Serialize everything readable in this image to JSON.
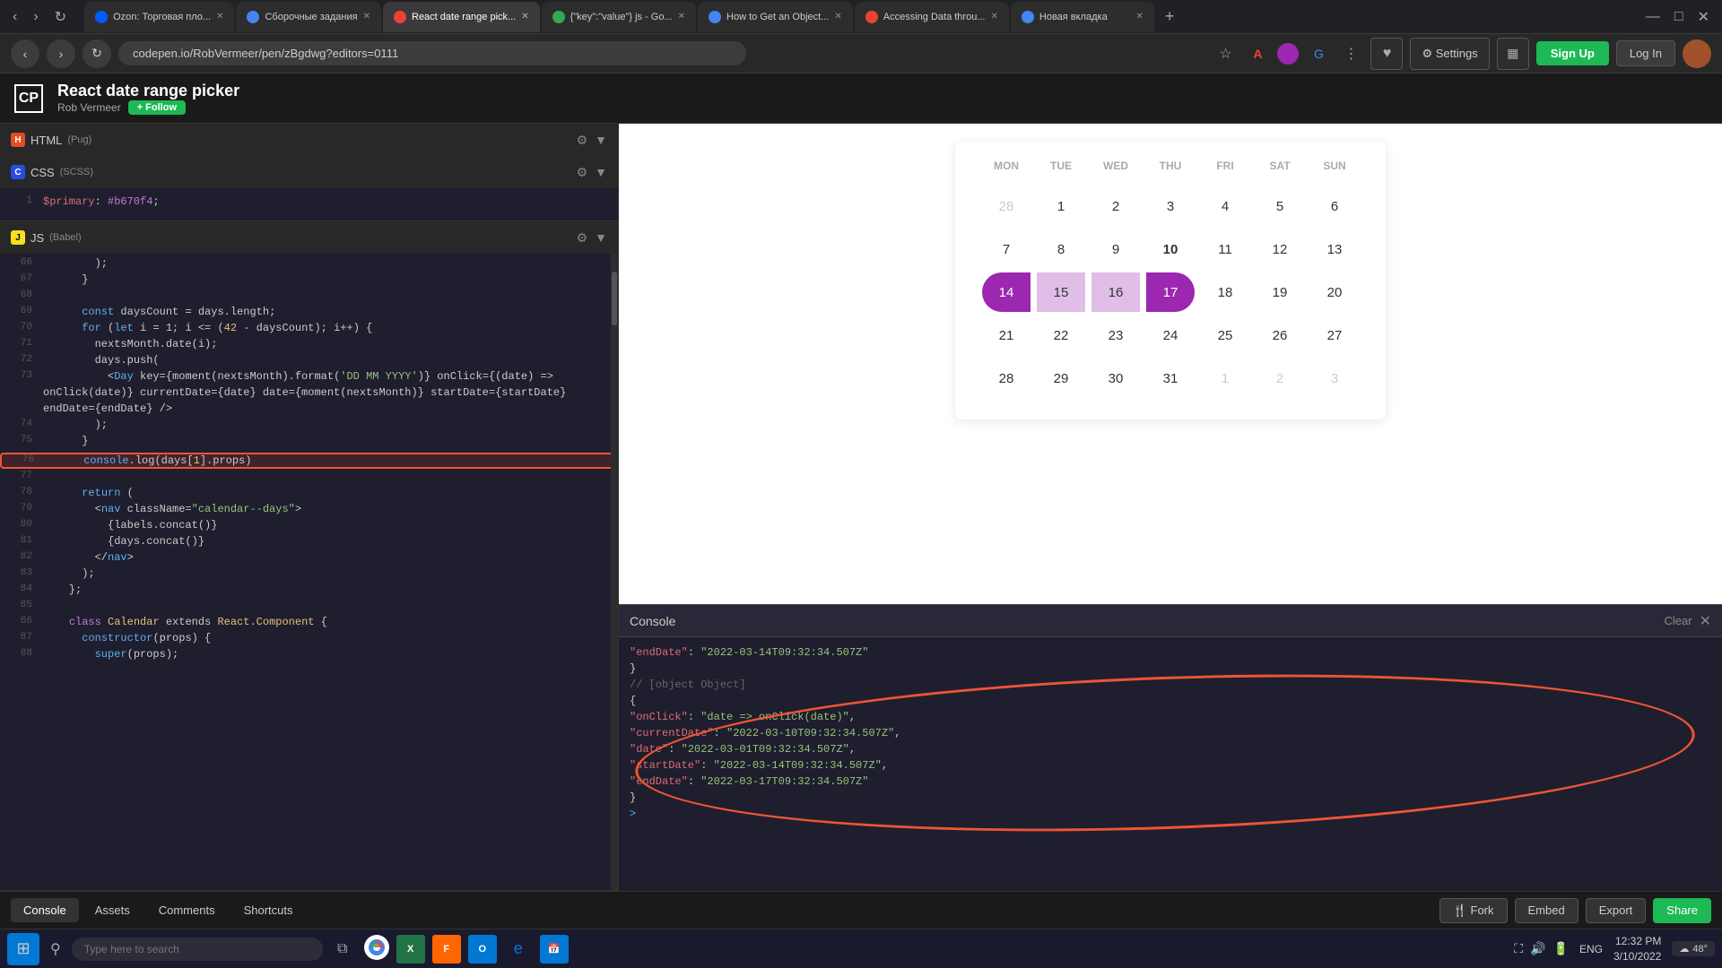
{
  "browser": {
    "tabs": [
      {
        "id": "tab1",
        "label": "Ozon: Торговая пло...",
        "favicon": "ozon",
        "active": false
      },
      {
        "id": "tab2",
        "label": "Сборочные задания",
        "favicon": "blue",
        "active": false
      },
      {
        "id": "tab3",
        "label": "React date range pick...",
        "favicon": "orange",
        "active": true
      },
      {
        "id": "tab4",
        "label": "{\"key\":\"value\"} js - Go...",
        "favicon": "green",
        "active": false
      },
      {
        "id": "tab5",
        "label": "How to Get an Object...",
        "favicon": "blue",
        "active": false
      },
      {
        "id": "tab6",
        "label": "Accessing Data throu...",
        "favicon": "orange",
        "active": false
      },
      {
        "id": "tab7",
        "label": "Новая вкладка",
        "favicon": "blue",
        "active": false
      }
    ],
    "url": "codepen.io/RobVermeer/pen/zBgdwg?editors=0111"
  },
  "header": {
    "title": "React date range picker",
    "author": "Rob Vermeer",
    "follow_label": "+ Follow",
    "heart_icon": "♥",
    "settings_label": "⚙ Settings",
    "grid_icon": "▦",
    "sign_up_label": "Sign Up",
    "log_in_label": "Log In"
  },
  "editors": {
    "html": {
      "lang": "HTML",
      "sub": "(Pug)",
      "icon_bg": "#e34c26"
    },
    "css": {
      "lang": "CSS",
      "sub": "(SCSS)",
      "icon_bg": "#264de4"
    },
    "js": {
      "lang": "JS",
      "sub": "(Babel)",
      "icon_bg": "#f7df1e"
    }
  },
  "code_lines": [
    {
      "num": "",
      "content": ""
    },
    {
      "num": "66",
      "content": "        );"
    },
    {
      "num": "67",
      "content": "      }"
    },
    {
      "num": "68",
      "content": ""
    },
    {
      "num": "69",
      "content": "      const daysCount = days.length;"
    },
    {
      "num": "70",
      "content": "      for (let i = 1; i <= (42 - daysCount); i++) {"
    },
    {
      "num": "71",
      "content": "        nextsMonth.date(i);"
    },
    {
      "num": "72",
      "content": "        days.push("
    },
    {
      "num": "73",
      "content": "          <Day key={moment(nextsMonth).format('DD MM YYYY')} onClick={(date) =>"
    },
    {
      "num": "",
      "content": "onClick(date)} currentDate={date} date={moment(nextsMonth)} startDate={startDate}"
    },
    {
      "num": "",
      "content": "endDate={endDate} />"
    },
    {
      "num": "74",
      "content": "        );"
    },
    {
      "num": "75",
      "content": "      }"
    },
    {
      "num": "76",
      "content": "      console.log(days[1].props)",
      "highlight": true
    },
    {
      "num": "77",
      "content": ""
    },
    {
      "num": "78",
      "content": "      return ("
    },
    {
      "num": "79",
      "content": "        <nav className=\"calendar--days\">"
    },
    {
      "num": "80",
      "content": "          {labels.concat()}"
    },
    {
      "num": "81",
      "content": "          {days.concat()}"
    },
    {
      "num": "82",
      "content": "        </nav>"
    },
    {
      "num": "83",
      "content": "      );"
    },
    {
      "num": "84",
      "content": "    };"
    },
    {
      "num": "85",
      "content": ""
    },
    {
      "num": "86",
      "content": "    class Calendar extends React.Component {"
    },
    {
      "num": "87",
      "content": "      constructor(props) {"
    },
    {
      "num": "88",
      "content": "        super(props);"
    }
  ],
  "css_code": [
    {
      "num": "1",
      "content": "  $primary: #b670f4;"
    }
  ],
  "calendar": {
    "days_of_week": [
      "MON",
      "TUE",
      "WED",
      "THU",
      "FRI",
      "SAT",
      "SUN"
    ],
    "rows": [
      [
        {
          "day": "28",
          "type": "other-month"
        },
        {
          "day": "1",
          "type": "normal"
        },
        {
          "day": "2",
          "type": "normal"
        },
        {
          "day": "3",
          "type": "normal"
        },
        {
          "day": "4",
          "type": "normal"
        },
        {
          "day": "5",
          "type": "normal"
        },
        {
          "day": "6",
          "type": "normal"
        }
      ],
      [
        {
          "day": "7",
          "type": "normal"
        },
        {
          "day": "8",
          "type": "normal"
        },
        {
          "day": "9",
          "type": "normal"
        },
        {
          "day": "10",
          "type": "today"
        },
        {
          "day": "11",
          "type": "normal"
        },
        {
          "day": "12",
          "type": "normal"
        },
        {
          "day": "13",
          "type": "normal"
        }
      ],
      [
        {
          "day": "14",
          "type": "selected-start"
        },
        {
          "day": "15",
          "type": "selected-mid"
        },
        {
          "day": "16",
          "type": "selected-mid"
        },
        {
          "day": "17",
          "type": "selected-end"
        },
        {
          "day": "18",
          "type": "normal"
        },
        {
          "day": "19",
          "type": "normal"
        },
        {
          "day": "20",
          "type": "normal"
        }
      ],
      [
        {
          "day": "21",
          "type": "normal"
        },
        {
          "day": "22",
          "type": "normal"
        },
        {
          "day": "23",
          "type": "normal"
        },
        {
          "day": "24",
          "type": "normal"
        },
        {
          "day": "25",
          "type": "normal"
        },
        {
          "day": "26",
          "type": "normal"
        },
        {
          "day": "27",
          "type": "normal"
        }
      ],
      [
        {
          "day": "28",
          "type": "normal"
        },
        {
          "day": "29",
          "type": "normal"
        },
        {
          "day": "30",
          "type": "normal"
        },
        {
          "day": "31",
          "type": "normal"
        },
        {
          "day": "1",
          "type": "other-month"
        },
        {
          "day": "2",
          "type": "other-month"
        },
        {
          "day": "3",
          "type": "other-month"
        }
      ]
    ]
  },
  "console": {
    "title": "Console",
    "clear_label": "Clear",
    "close_icon": "✕",
    "lines": [
      {
        "type": "string",
        "text": "  \"endDate\": \"2022-03-14T09:32:34.507Z\""
      },
      {
        "type": "bracket",
        "text": "}"
      },
      {
        "type": "empty",
        "text": ""
      },
      {
        "type": "comment",
        "text": "// [object Object]"
      },
      {
        "type": "bracket",
        "text": "{"
      },
      {
        "type": "property",
        "text": "  \"onClick\": \"date => onClick(date)\","
      },
      {
        "type": "property",
        "text": "  \"currentDate\": \"2022-03-10T09:32:34.507Z\","
      },
      {
        "type": "property",
        "text": "  \"date\": \"2022-03-01T09:32:34.507Z\","
      },
      {
        "type": "property",
        "text": "  \"startDate\": \"2022-03-14T09:32:34.507Z\","
      },
      {
        "type": "property",
        "text": "  \"endDate\": \"2022-03-17T09:32:34.507Z\""
      },
      {
        "type": "bracket",
        "text": "}"
      },
      {
        "type": "prompt",
        "text": ">"
      }
    ]
  },
  "bottom_tabs": [
    {
      "label": "Console",
      "active": true
    },
    {
      "label": "Assets",
      "active": false
    },
    {
      "label": "Comments",
      "active": false
    },
    {
      "label": "Shortcuts",
      "active": false
    }
  ],
  "bottom_actions": [
    {
      "label": "🍴 Fork",
      "id": "fork"
    },
    {
      "label": "Embed",
      "id": "embed"
    },
    {
      "label": "Export",
      "id": "export"
    },
    {
      "label": "Share",
      "id": "share"
    }
  ],
  "taskbar": {
    "search_placeholder": "Type here to search",
    "time": "12:32 PM",
    "date": "3/10/2022",
    "weather": "48°",
    "language": "ENG"
  }
}
